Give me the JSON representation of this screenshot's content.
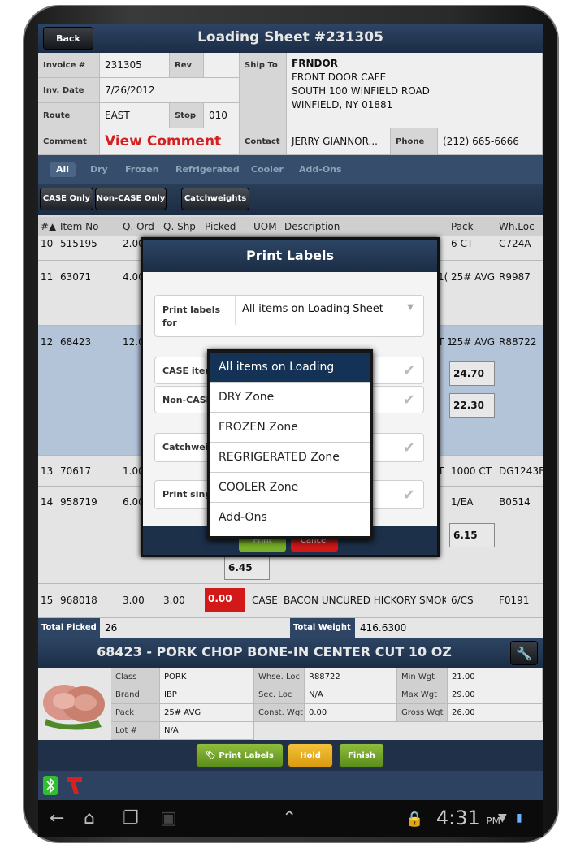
{
  "titlebar": {
    "back_label": "Back",
    "title": "Loading Sheet #231305"
  },
  "header": {
    "invoice_label": "Invoice #",
    "invoice_value": "231305",
    "rev_label": "Rev",
    "rev_value": "",
    "invdate_label": "Inv. Date",
    "invdate_value": "7/26/2012",
    "route_label": "Route",
    "route_value": "EAST",
    "stop_label": "Stop",
    "stop_value": "010",
    "comment_label": "Comment",
    "comment_value": "View Comment",
    "shipto_label": "Ship To",
    "shipto_lines": [
      "FRNDOR",
      "FRONT DOOR CAFE",
      "SOUTH 100 WINFIELD ROAD",
      "WINFIELD, NY 01881"
    ],
    "contact_label": "Contact",
    "contact_value": "JERRY GIANNOR...",
    "phone_label": "Phone",
    "phone_value": "(212) 665-6666"
  },
  "filters": [
    "All",
    "Dry",
    "Frozen",
    "Refrigerated",
    "Cooler",
    "Add-Ons"
  ],
  "buttons": {
    "case_only": "CASE Only",
    "noncase_only": "Non-CASE Only",
    "catchweights": "Catchweights"
  },
  "columns": [
    "#▲",
    "Item No",
    "Q. Ord",
    "Q. Shp",
    "Picked",
    "UOM",
    "Description",
    "Pack",
    "Wh.Loc"
  ],
  "rows": [
    {
      "num": "10",
      "item": "515195",
      "qord": "2.00",
      "pack": "6 CT",
      "loc": "C724A"
    },
    {
      "num": "11",
      "item": "63071",
      "qord": "4.00",
      "desc_tail": "1(",
      "pack": "25# AVG",
      "loc": "R9987"
    },
    {
      "num": "12",
      "item": "68423",
      "qord": "12.0",
      "desc_tail": "T 1",
      "pack": "25# AVG",
      "loc": "R88722",
      "w1": "24.70",
      "w2": "22.30"
    },
    {
      "num": "13",
      "item": "70617",
      "qord": "1.00",
      "desc_tail": "T",
      "pack": "1000 CT",
      "loc": "DG1243B"
    },
    {
      "num": "14",
      "item": "958719",
      "qord": "6.00",
      "pack": "1/EA",
      "loc": "B0514",
      "w1": "6.15",
      "w2": "6.45"
    },
    {
      "num": "15",
      "item": "968018",
      "qord": "3.00",
      "qshp": "3.00",
      "picked": "0.00",
      "uom": "CASE",
      "desc": "BACON UNCURED HICKORY SMOKEI",
      "pack": "6/CS",
      "loc": "F0191"
    }
  ],
  "totals": {
    "picked_label": "Total Picked",
    "picked_value": "26",
    "weight_label": "Total Weight",
    "weight_value": "416.6300"
  },
  "item_title": "68423 - PORK CHOP BONE-IN CENTER CUT 10 OZ",
  "detail": {
    "class_label": "Class",
    "class_value": "PORK",
    "brand_label": "Brand",
    "brand_value": "IBP",
    "pack_label": "Pack",
    "pack_value": "25# AVG",
    "lot_label": "Lot #",
    "lot_value": "N/A",
    "whse_label": "Whse. Loc",
    "whse_value": "R88722",
    "sec_label": "Sec. Loc",
    "sec_value": "N/A",
    "const_label": "Const. Wgt",
    "const_value": "0.00",
    "min_label": "Min Wgt",
    "min_value": "21.00",
    "max_label": "Max Wgt",
    "max_value": "29.00",
    "gross_label": "Gross Wgt",
    "gross_value": "26.00"
  },
  "actions": {
    "print": "Print Labels",
    "hold": "Hold",
    "finish": "Finish"
  },
  "modal": {
    "title": "Print Labels",
    "for_label": "Print labels for",
    "for_value": "All items on Loading Sheet",
    "case_label": "CASE item",
    "noncase_label": "Non-CASE",
    "catch_label": "Catchweig",
    "single_label": "Print sing",
    "print_btn": "Print",
    "cancel_btn": "Cancel"
  },
  "dropdown_options": [
    "All items on Loading Sheet",
    "DRY Zone",
    "FROZEN Zone",
    "REGRIGERATED Zone",
    "COOLER Zone",
    "Add-Ons"
  ],
  "status": {
    "time": "4:31",
    "ampm": "PM"
  },
  "colors": {
    "header_blue": "#1b2d45",
    "accent_red": "#d42020",
    "green": "#5a8d1c",
    "orange": "#d99a10"
  }
}
